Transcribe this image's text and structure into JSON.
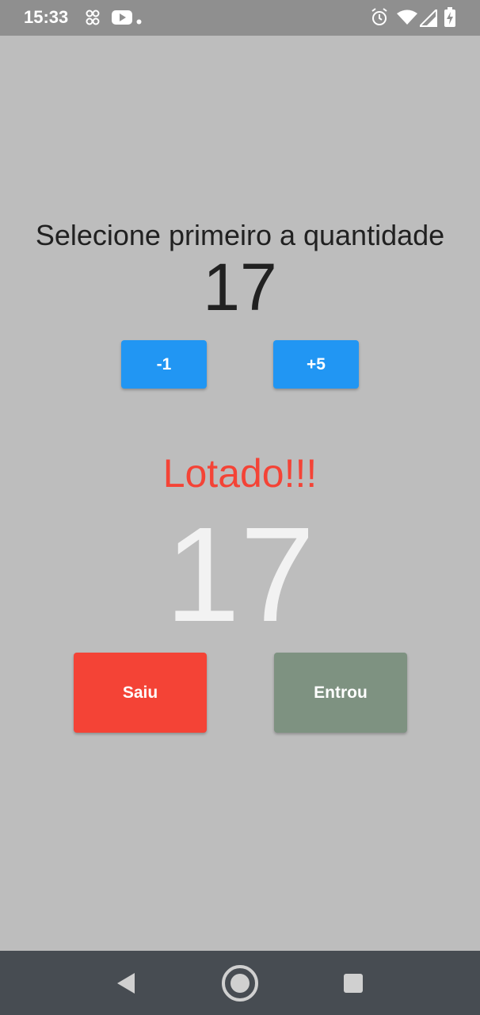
{
  "status_bar": {
    "time": "15:33",
    "icons": [
      "fan-icon",
      "youtube-icon",
      "dot-icon",
      "alarm-icon",
      "wifi-icon",
      "signal-icon",
      "battery-charging-icon"
    ]
  },
  "main": {
    "title": "Selecione primeiro a quantidade",
    "quantity": "17",
    "minus_label": "-1",
    "plus_label": "+5",
    "status_text": "Lotado!!!",
    "count": "17",
    "exit_label": "Saiu",
    "enter_label": "Entrou"
  },
  "colors": {
    "background": "#bdbdbd",
    "accent_blue": "#2196f3",
    "status_red": "#f44336",
    "enter_green": "#7e9281"
  },
  "nav_bar": {
    "icons": [
      "back-icon",
      "home-icon",
      "recents-icon"
    ]
  }
}
